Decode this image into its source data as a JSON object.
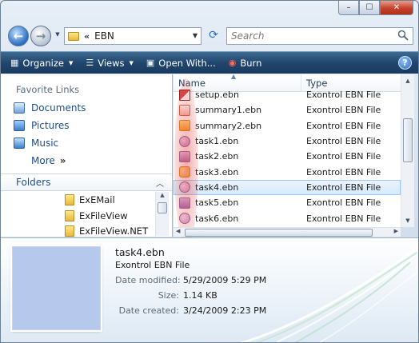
{
  "window": {
    "minimize_glyph": "–",
    "maximize_glyph": "☐",
    "close_glyph": "✕"
  },
  "address": {
    "chevrons": "«",
    "path": "EBN"
  },
  "search": {
    "placeholder": "Search"
  },
  "toolbar": {
    "organize_label": "Organize",
    "views_label": "Views",
    "open_with_label": "Open With...",
    "burn_label": "Burn"
  },
  "nav_pane": {
    "favorites_title": "Favorite Links",
    "favorites": [
      {
        "label": "Documents"
      },
      {
        "label": "Pictures"
      },
      {
        "label": "Music"
      }
    ],
    "more_label": "More",
    "folders_title": "Folders",
    "tree": [
      {
        "label": "ExEMail"
      },
      {
        "label": "ExFileView"
      },
      {
        "label": "ExFileView.NET"
      }
    ]
  },
  "file_list": {
    "columns": [
      {
        "label": "Name"
      },
      {
        "label": "Type"
      }
    ],
    "rows": [
      {
        "name": "setup.ebn",
        "type": "Exontrol EBN File"
      },
      {
        "name": "summary1.ebn",
        "type": "Exontrol EBN File"
      },
      {
        "name": "summary2.ebn",
        "type": "Exontrol EBN File"
      },
      {
        "name": "task1.ebn",
        "type": "Exontrol EBN File"
      },
      {
        "name": "task2.ebn",
        "type": "Exontrol EBN File"
      },
      {
        "name": "task3.ebn",
        "type": "Exontrol EBN File"
      },
      {
        "name": "task4.ebn",
        "type": "Exontrol EBN File"
      },
      {
        "name": "task5.ebn",
        "type": "Exontrol EBN File"
      },
      {
        "name": "task6.ebn",
        "type": "Exontrol EBN File"
      }
    ],
    "selected_index": 6
  },
  "details": {
    "file_name": "task4.ebn",
    "file_type": "Exontrol EBN File",
    "date_modified_label": "Date modified:",
    "date_modified": "5/29/2009 5:29 PM",
    "size_label": "Size:",
    "size": "1.14 KB",
    "date_created_label": "Date created:",
    "date_created": "3/24/2009 2:23 PM"
  },
  "colors": {
    "toolbar_bg": "#21466d",
    "link_blue": "#1d4e89",
    "selection_bg": "#d6e9fb",
    "highlight_red": "#e64646"
  }
}
